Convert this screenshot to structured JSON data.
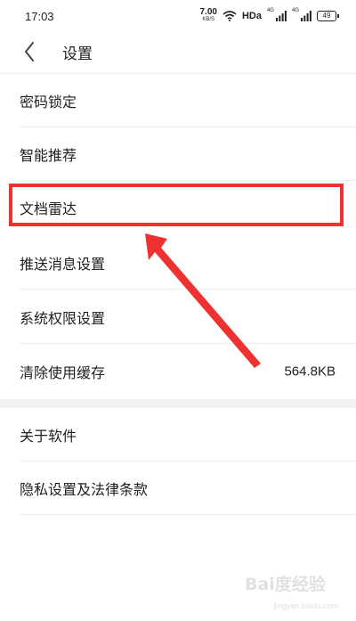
{
  "status_bar": {
    "time": "17:03",
    "net_speed_value": "7.00",
    "net_speed_unit": "KB/S",
    "hd_label": "HDa",
    "sig1_label": "4G",
    "sig2_label": "4G",
    "battery": "49"
  },
  "header": {
    "title": "设置"
  },
  "menu_items": [
    {
      "label": "密码锁定"
    },
    {
      "label": "智能推荐"
    },
    {
      "label": "文档雷达"
    },
    {
      "label": "推送消息设置"
    },
    {
      "label": "系统权限设置"
    },
    {
      "label": "清除使用缓存",
      "value": "564.8KB"
    }
  ],
  "menu_items_2": [
    {
      "label": "关于软件"
    },
    {
      "label": "隐私设置及法律条款"
    }
  ],
  "annotation": {
    "color": "#ee3232"
  },
  "watermark": {
    "brand": "Bai度经验",
    "url": "jingyan.baidu.com"
  }
}
